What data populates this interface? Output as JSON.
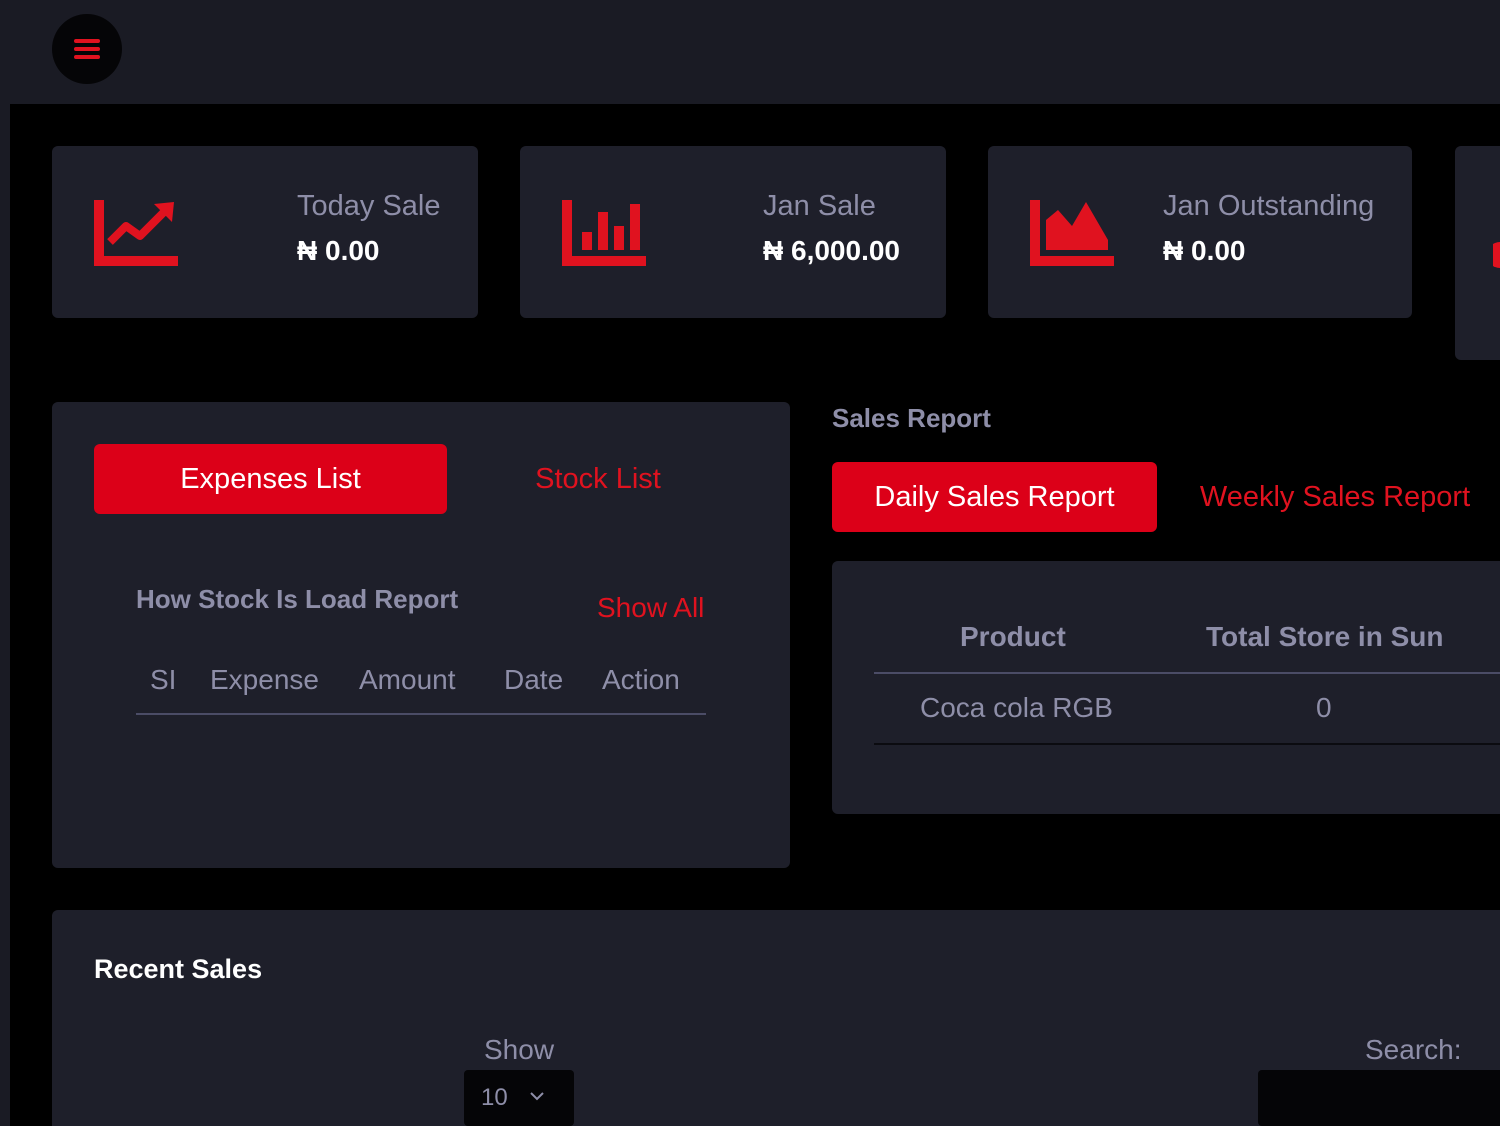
{
  "topbar": {
    "menu_icon": "hamburger-icon"
  },
  "colors": {
    "accent": "#dc0018",
    "panel": "#1e1f2a",
    "background": "#000000",
    "muted_text": "#8e8ea8"
  },
  "stats": [
    {
      "label": "Today Sale",
      "value": "₦ 0.00",
      "icon": "line-chart-icon"
    },
    {
      "label": "Jan Sale",
      "value": "₦ 6,000.00",
      "icon": "bar-chart-icon"
    },
    {
      "label": "Jan Outstanding",
      "value": "₦ 0.00",
      "icon": "area-chart-icon"
    }
  ],
  "expenses": {
    "tabs": {
      "active": "Expenses List",
      "other": "Stock List"
    },
    "title": "How Stock Is Load Report",
    "show_all": "Show All",
    "columns": [
      "SI",
      "Expense",
      "Amount",
      "Date",
      "Action"
    ]
  },
  "sales_report": {
    "title": "Sales Report",
    "tabs": {
      "active": "Daily Sales Report",
      "other": "Weekly Sales Report"
    },
    "columns": [
      "Product",
      "Total Store in Sun"
    ],
    "rows": [
      {
        "product": "Coca cola RGB",
        "total": "0"
      }
    ]
  },
  "recent_sales": {
    "title": "Recent Sales",
    "show_label": "Show",
    "page_size": "10",
    "search_label": "Search:"
  }
}
